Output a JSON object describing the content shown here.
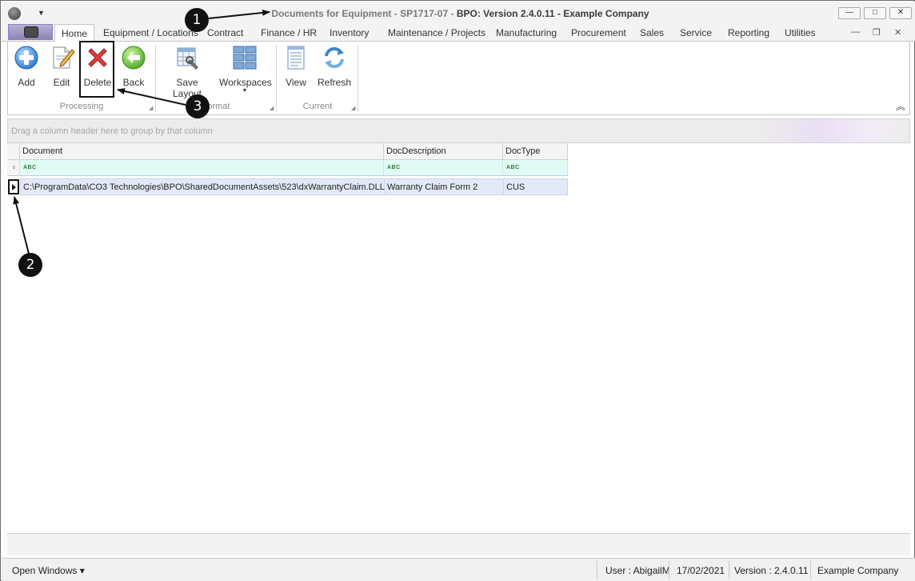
{
  "window": {
    "title_prefix": "Documents for Equipment - SP1717-07 - ",
    "title_suffix": "BPO: Version 2.4.0.11 - Example Company",
    "min": "—",
    "max": "□",
    "close": "✕"
  },
  "qat_arrow": "▼",
  "tabs": [
    {
      "label": "Home"
    },
    {
      "label": "Equipment / Locations"
    },
    {
      "label": "Contract"
    },
    {
      "label": "Finance / HR"
    },
    {
      "label": "Inventory"
    },
    {
      "label": "Maintenance / Projects"
    },
    {
      "label": "Manufacturing"
    },
    {
      "label": "Procurement"
    },
    {
      "label": "Sales"
    },
    {
      "label": "Service"
    },
    {
      "label": "Reporting"
    },
    {
      "label": "Utilities"
    }
  ],
  "ribbon_ctrls": {
    "min": "—",
    "restore": "❐",
    "close": "✕"
  },
  "ribbon": {
    "buttons": {
      "add": "Add",
      "edit": "Edit",
      "delete": "Delete",
      "back": "Back",
      "save_layout": "Save Layout",
      "workspaces": "Workspaces",
      "view": "View",
      "refresh": "Refresh"
    },
    "groups": {
      "processing": "Processing",
      "format": "Format",
      "current": "Current"
    },
    "dropdown_arrow": "▼",
    "collapse": "︽"
  },
  "group_panel_text": "Drag a column header here to group by that column",
  "grid": {
    "columns": [
      "Document",
      "DocDescription",
      "DocType"
    ],
    "filter_text": "ABC",
    "filter_pin": "📍",
    "rows": [
      {
        "document": "C:\\ProgramData\\CO3 Technologies\\BPO\\SharedDocumentAssets\\523\\dxWarrantyClaim.DLL",
        "description": "Warranty Claim Form 2",
        "type": "CUS"
      }
    ]
  },
  "status_bar": {
    "open_windows": "Open Windows ▾",
    "user": "User : AbigailM",
    "date": "17/02/2021",
    "version": "Version : 2.4.0.11",
    "company": "Example Company"
  },
  "callouts": {
    "one": "1",
    "two": "2",
    "three": "3"
  }
}
